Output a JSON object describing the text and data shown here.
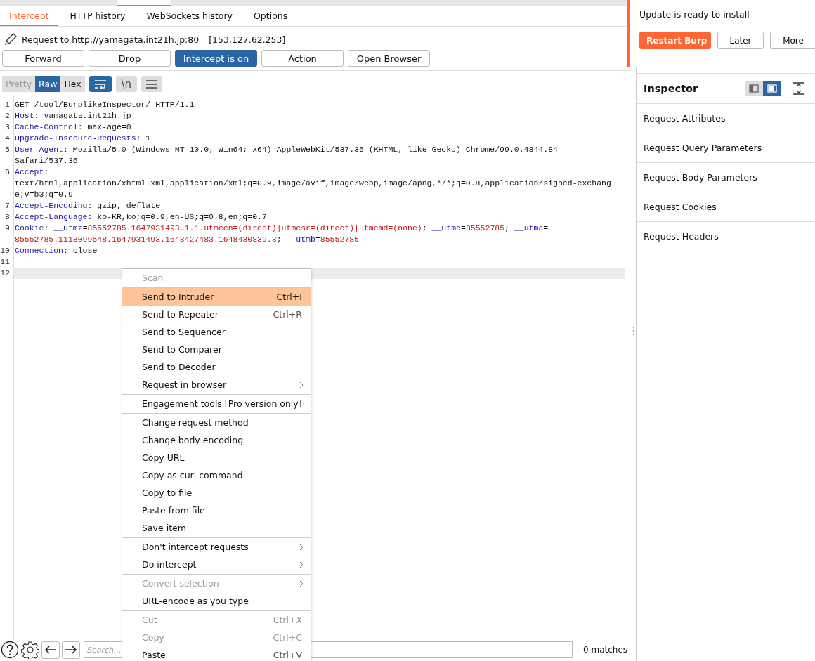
{
  "subtabs": [
    {
      "label": "Intercept",
      "selected": true
    },
    {
      "label": "HTTP history",
      "selected": false
    },
    {
      "label": "WebSockets history",
      "selected": false
    },
    {
      "label": "Options",
      "selected": false
    }
  ],
  "request_line": {
    "label": "Request to http://yamagata.int21h.jp:80",
    "ip": "[153.127.62.253]"
  },
  "buttons": [
    {
      "label": "Forward",
      "selected": false
    },
    {
      "label": "Drop",
      "selected": false
    },
    {
      "label": "Intercept is on",
      "selected": true
    },
    {
      "label": "Action",
      "selected": false
    },
    {
      "label": "Open Browser",
      "selected": false
    }
  ],
  "view_tabs": [
    {
      "label": "Pretty",
      "selected": false,
      "disabled": true
    },
    {
      "label": "Raw",
      "selected": true,
      "disabled": false
    },
    {
      "label": "Hex",
      "selected": false,
      "disabled": false
    }
  ],
  "toggles": [
    {
      "kind": "wrap",
      "on": true
    },
    {
      "kind": "newline",
      "label": "\\n",
      "on": false
    },
    {
      "kind": "menu",
      "on": false
    }
  ],
  "code": [
    {
      "number": "1",
      "parts": [
        {
          "segments": [
            {
              "kind": "plain",
              "text": "GET /tool/BurplikeInspector/ HTTP/1.1"
            }
          ]
        }
      ]
    },
    {
      "number": "2",
      "parts": [
        {
          "segments": [
            {
              "kind": "key",
              "text": "Host"
            },
            {
              "kind": "plain",
              "text": ": yamagata.int21h.jp"
            }
          ]
        }
      ]
    },
    {
      "number": "3",
      "parts": [
        {
          "segments": [
            {
              "kind": "key",
              "text": "Cache-Control"
            },
            {
              "kind": "plain",
              "text": ": max-age=0"
            }
          ]
        }
      ]
    },
    {
      "number": "4",
      "parts": [
        {
          "segments": [
            {
              "kind": "key",
              "text": "Upgrade-Insecure-Requests"
            },
            {
              "kind": "plain",
              "text": ": 1"
            }
          ]
        }
      ]
    },
    {
      "number": "5",
      "parts": [
        {
          "segments": [
            {
              "kind": "key",
              "text": "User-Agent"
            },
            {
              "kind": "plain",
              "text": ": Mozilla/5.0 (Windows NT 10.0; Win64; x64) AppleWebKit/537.36 (KHTML, like Gecko) Chrome/99.0.4844.84"
            }
          ]
        },
        {
          "segments": [
            {
              "kind": "plain",
              "text": "Safari/537.36"
            }
          ]
        }
      ]
    },
    {
      "number": "6",
      "parts": [
        {
          "segments": [
            {
              "kind": "key",
              "text": "Accept"
            },
            {
              "kind": "plain",
              "text": ":"
            }
          ]
        },
        {
          "segments": [
            {
              "kind": "plain",
              "text": "text/html,application/xhtml+xml,application/xml;q=0.9,image/avif,image/webp,image/apng,*/*;q=0.8,application/signed-exchang"
            }
          ]
        },
        {
          "segments": [
            {
              "kind": "plain",
              "text": "e;v=b3;q=0.9"
            }
          ]
        }
      ]
    },
    {
      "number": "7",
      "parts": [
        {
          "segments": [
            {
              "kind": "key",
              "text": "Accept-Encoding"
            },
            {
              "kind": "plain",
              "text": ": gzip, deflate"
            }
          ]
        }
      ]
    },
    {
      "number": "8",
      "parts": [
        {
          "segments": [
            {
              "kind": "key",
              "text": "Accept-Language"
            },
            {
              "kind": "plain",
              "text": ": ko-KR,ko;q=0.9,en-US;q=0.8,en;q=0.7"
            }
          ]
        }
      ]
    },
    {
      "number": "9",
      "parts": [
        {
          "segments": [
            {
              "kind": "key",
              "text": "Cookie"
            },
            {
              "kind": "plain",
              "text": ": "
            },
            {
              "kind": "key",
              "text": "__utmz"
            },
            {
              "kind": "plain",
              "text": "="
            },
            {
              "kind": "value",
              "text": "85552785.1647931493.1.1.utmccn=(direct)|utmcsr=(direct)|utmcmd=(none)"
            },
            {
              "kind": "plain",
              "text": "; "
            },
            {
              "kind": "key",
              "text": "__utmc"
            },
            {
              "kind": "plain",
              "text": "="
            },
            {
              "kind": "value",
              "text": "85552785"
            },
            {
              "kind": "plain",
              "text": "; "
            },
            {
              "kind": "key",
              "text": "__utma"
            },
            {
              "kind": "plain",
              "text": "="
            }
          ]
        },
        {
          "segments": [
            {
              "kind": "value",
              "text": "85552785.1118099548.1647931493.1648427483.1648430839.3"
            },
            {
              "kind": "plain",
              "text": "; "
            },
            {
              "kind": "key",
              "text": "__utmb"
            },
            {
              "kind": "plain",
              "text": "="
            },
            {
              "kind": "value",
              "text": "85552785"
            }
          ]
        }
      ]
    },
    {
      "number": "10",
      "parts": [
        {
          "segments": [
            {
              "kind": "key",
              "text": "Connection"
            },
            {
              "kind": "plain",
              "text": ": close"
            }
          ]
        }
      ]
    },
    {
      "number": "11"
    },
    {
      "number": "12",
      "current": true
    }
  ],
  "context_menu": [
    [
      {
        "label": "Scan",
        "disabled": true,
        "selected": false
      }
    ],
    [
      {
        "label": "Send to Intruder",
        "shortcut": "Ctrl+I",
        "disabled": false,
        "selected": true
      },
      {
        "label": "Send to Repeater",
        "shortcut": "Ctrl+R",
        "disabled": false,
        "selected": false
      },
      {
        "label": "Send to Sequencer",
        "disabled": false,
        "selected": false
      },
      {
        "label": "Send to Comparer",
        "disabled": false,
        "selected": false
      },
      {
        "label": "Send to Decoder",
        "disabled": false,
        "selected": false
      },
      {
        "label": "Request in browser",
        "submenu": true,
        "disabled": false,
        "selected": false
      }
    ],
    [
      {
        "label": "Engagement tools [Pro version only]",
        "submenu": true,
        "disabled": false,
        "selected": false
      }
    ],
    [
      {
        "label": "Change request method",
        "disabled": false,
        "selected": false
      },
      {
        "label": "Change body encoding",
        "disabled": false,
        "selected": false
      },
      {
        "label": "Copy URL",
        "disabled": false,
        "selected": false
      },
      {
        "label": "Copy as curl command",
        "disabled": false,
        "selected": false
      },
      {
        "label": "Copy to file",
        "disabled": false,
        "selected": false
      },
      {
        "label": "Paste from file",
        "disabled": false,
        "selected": false
      },
      {
        "label": "Save item",
        "disabled": false,
        "selected": false
      }
    ],
    [
      {
        "label": "Don't intercept requests",
        "submenu": true,
        "disabled": false,
        "selected": false
      },
      {
        "label": "Do intercept",
        "submenu": true,
        "disabled": false,
        "selected": false
      }
    ],
    [
      {
        "label": "Convert selection",
        "submenu": true,
        "disabled": true,
        "selected": false
      },
      {
        "label": "URL-encode as you type",
        "disabled": false,
        "selected": false
      }
    ],
    [
      {
        "label": "Cut",
        "shortcut": "Ctrl+X",
        "disabled": true,
        "selected": false
      },
      {
        "label": "Copy",
        "shortcut": "Ctrl+C",
        "disabled": true,
        "selected": false
      },
      {
        "label": "Paste",
        "shortcut": "Ctrl+V",
        "disabled": false,
        "selected": false
      }
    ]
  ],
  "search": {
    "placeholder": "Search...",
    "matches": "0 matches"
  },
  "inspector": {
    "title": "Inspector",
    "layout_buttons": [
      {
        "selected": false
      },
      {
        "selected": true
      }
    ],
    "sections": [
      "Request Attributes",
      "Request Query Parameters",
      "Request Body Parameters",
      "Request Cookies",
      "Request Headers"
    ]
  },
  "notification": {
    "message": "Update is ready to install",
    "buttons": [
      {
        "label": "Restart Burp",
        "primary": true
      },
      {
        "label": "Later",
        "primary": false
      },
      {
        "label": "More",
        "primary": false
      }
    ]
  }
}
